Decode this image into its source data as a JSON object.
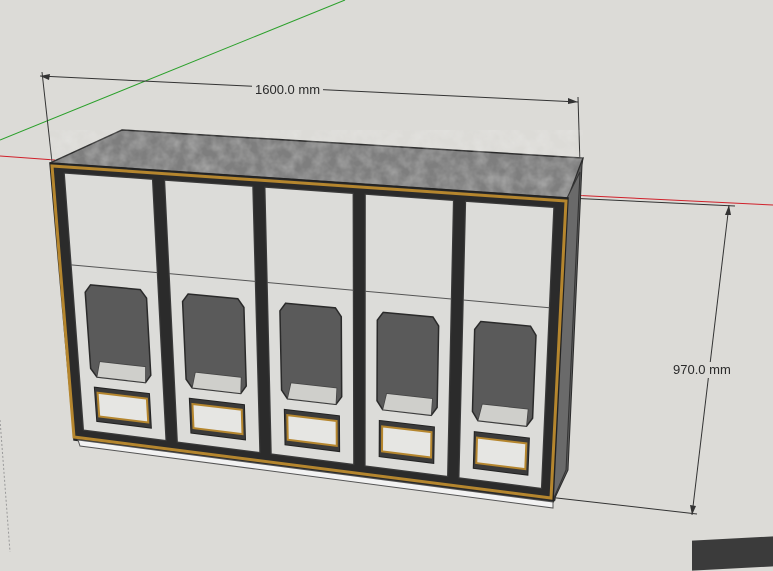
{
  "app": {
    "type": "3D modeling viewport"
  },
  "dimensions": {
    "width_label": "1600.0 mm",
    "height_label": "970.0 mm"
  },
  "model": {
    "door_count": 5
  },
  "colors": {
    "background": "#dcdbd7",
    "axis_red": "#d0202a",
    "axis_green": "#2aa02a",
    "trim_gold": "#b5862e",
    "panel_light": "#dedfdc",
    "cabinet_dark": "#3a3a3a"
  }
}
